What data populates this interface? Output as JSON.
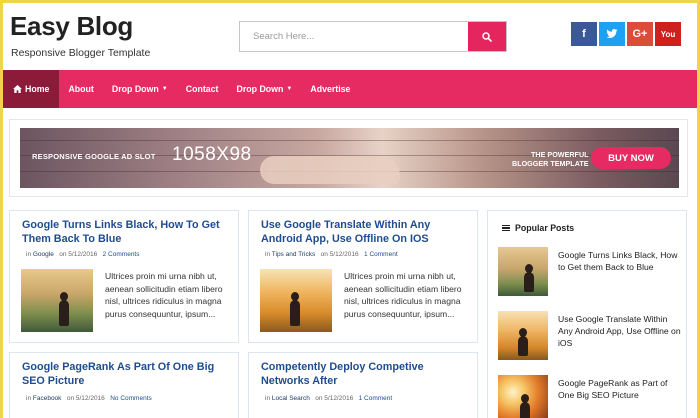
{
  "header": {
    "title": "Easy Blog",
    "subtitle": "Responsive Blogger Template",
    "search_placeholder": "Search Here...",
    "social": {
      "facebook": "f",
      "twitter": "t",
      "googleplus": "G+",
      "youtube": "You"
    }
  },
  "nav": {
    "items": [
      {
        "label": "Home",
        "icon": "home-icon",
        "active": true
      },
      {
        "label": "About"
      },
      {
        "label": "Drop Down",
        "dropdown": true
      },
      {
        "label": "Contact"
      },
      {
        "label": "Drop Down",
        "dropdown": true
      },
      {
        "label": "Advertise"
      }
    ]
  },
  "ad": {
    "left_text": "RESPONSIVE GOOGLE AD SLOT",
    "size_text": "1058X98",
    "right_text_1": "THE POWERFUL",
    "right_text_2": "BLOGGER TEMPLATE",
    "button": "BUY NOW"
  },
  "posts": [
    {
      "title": "Google Turns Links Black, How To Get Them Back To Blue",
      "meta_in": "in",
      "category": "Google",
      "date": "on 5/12/2016",
      "comments": "2 Comments",
      "excerpt": "Ultrices proin mi urna nibh ut, aenean sollicitudin etiam libero nisl, ultrices ridiculus in magna purus consequuntur, ipsum..."
    },
    {
      "title": "Use Google Translate Within Any Android App, Use Offline On IOS",
      "meta_in": "in",
      "category": "Tips and Tricks",
      "date": "on 5/12/2016",
      "comments": "1 Comment",
      "excerpt": "Ultrices proin mi urna nibh ut, aenean sollicitudin etiam libero nisl, ultrices ridiculus in magna purus consequuntur, ipsum..."
    },
    {
      "title": "Google PageRank As Part Of One Big SEO Picture",
      "meta_in": "in",
      "category": "Facebook",
      "date": "on 5/12/2016",
      "comments": "No Comments"
    },
    {
      "title": "Competently Deploy Competive Networks After",
      "meta_in": "in",
      "category": "Local Search",
      "date": "on 5/12/2016",
      "comments": "1 Comment"
    }
  ],
  "sidebar": {
    "heading": "Popular Posts",
    "items": [
      {
        "title": "Google Turns Links Black, How to Get them Back to Blue"
      },
      {
        "title": "Use Google Translate Within Any Android App, Use Offline on iOS"
      },
      {
        "title": "Google PageRank as Part of One Big SEO Picture"
      }
    ]
  },
  "colors": {
    "accent": "#e62a62",
    "nav_active": "#8c1b3a",
    "post_title": "#1f4c8f",
    "frame": "#f2d44a"
  }
}
